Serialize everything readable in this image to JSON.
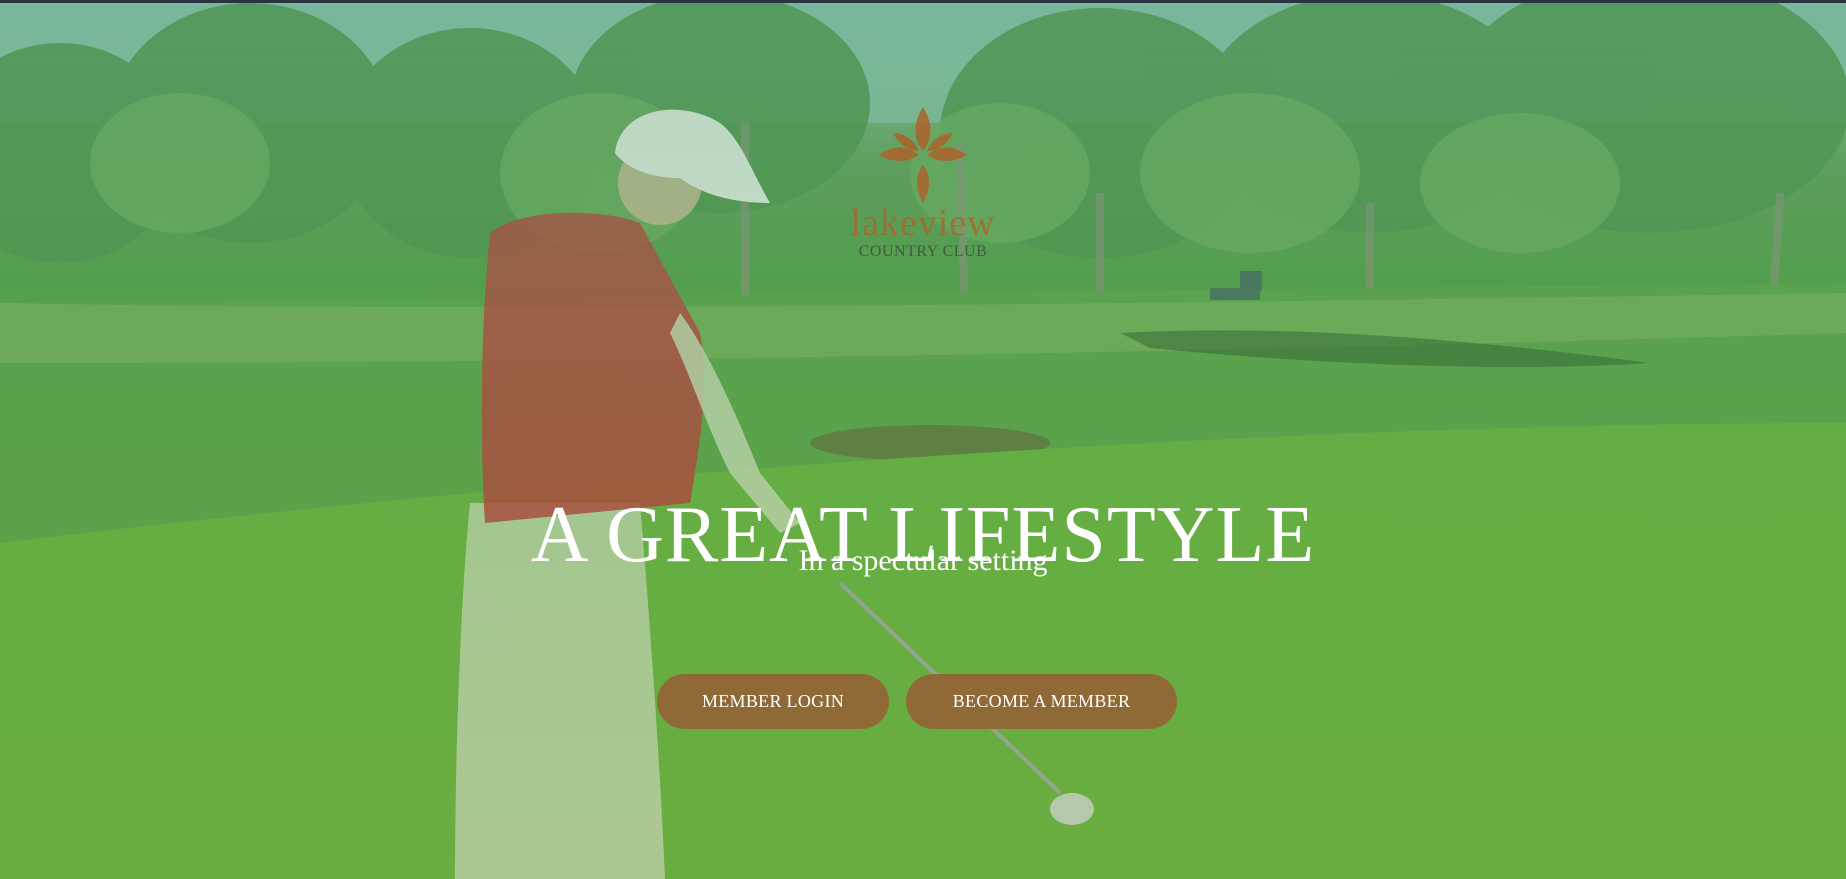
{
  "logo": {
    "icon": "lakeview-flower-logo",
    "name": "lakeview",
    "tagline": "COUNTRY CLUB",
    "color": "#a8672e"
  },
  "hero": {
    "title": "A GREAT LIFESTYLE",
    "subtitle": "In a spectular setting",
    "image": "golfer-putting-on-green"
  },
  "actions": {
    "login_label": "MEMBER LOGIN",
    "join_label": "BECOME A MEMBER",
    "button_color": "#8f6a36"
  }
}
